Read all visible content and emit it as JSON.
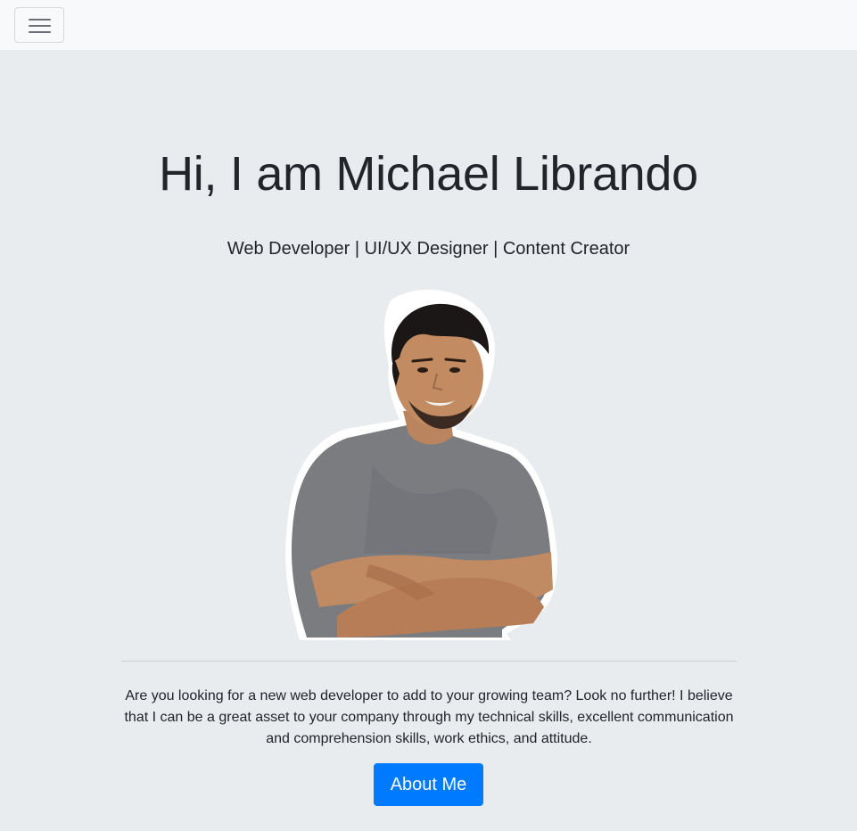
{
  "navbar": {
    "toggler_icon": "hamburger-menu-icon",
    "background": "#f8f9fa"
  },
  "hero": {
    "title": "Hi, I am Michael Librando",
    "subtitle": "Web Developer | UI/UX Designer | Content Creator",
    "portrait_alt": "portrait-photo",
    "description": "Are you looking for a new web developer to add to your growing team? Look no further! I believe that I can be a great asset to your company through my technical skills, excellent communication and comprehension skills, work ethics, and attitude.",
    "button_label": "About Me",
    "background": "#e9ecef"
  },
  "colors": {
    "primary": "#007bff",
    "text": "#212529"
  }
}
